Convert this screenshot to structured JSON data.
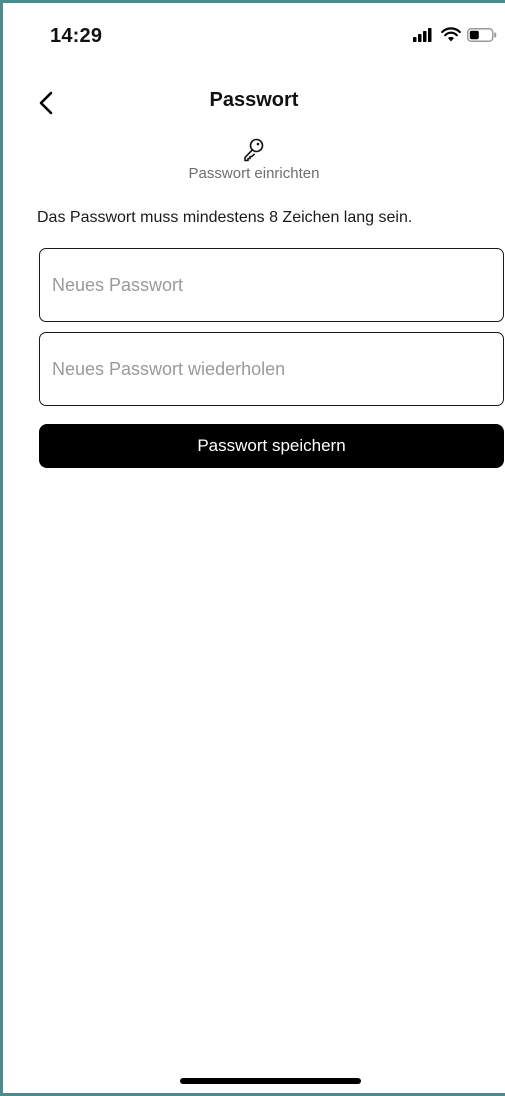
{
  "status_bar": {
    "time": "14:29",
    "icons": [
      "signal-icon",
      "wifi-icon",
      "battery-icon"
    ]
  },
  "nav": {
    "back_icon": "chevron-left-icon",
    "title": "Passwort"
  },
  "section": {
    "icon": "key-icon",
    "subtitle": "Passwort einrichten"
  },
  "hint": "Das Passwort muss mindestens 8 Zeichen lang sein.",
  "form": {
    "new_password": {
      "value": "",
      "placeholder": "Neues Passwort"
    },
    "repeat_password": {
      "value": "",
      "placeholder": "Neues Passwort wiederholen"
    },
    "save_label": "Passwort speichern"
  },
  "colors": {
    "frame_border": "#4a8b8b",
    "button_bg": "#000000",
    "button_text": "#ffffff",
    "placeholder": "#9a9a9a",
    "subtitle": "#6f6f6f"
  }
}
